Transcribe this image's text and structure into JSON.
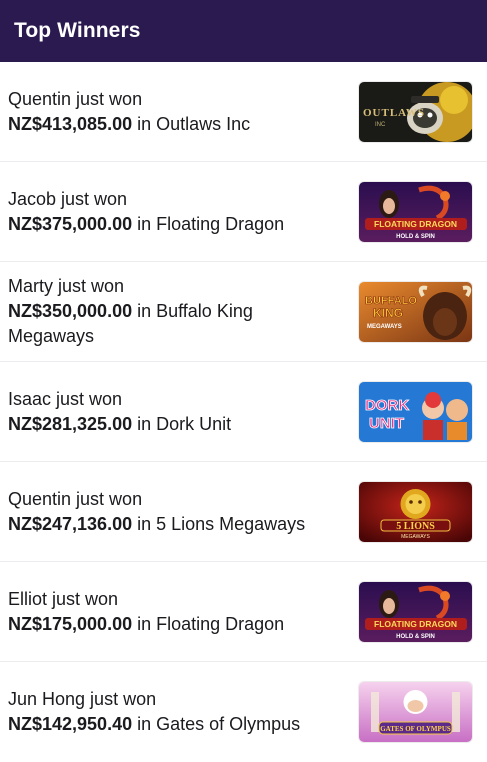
{
  "header": {
    "title": "Top Winners"
  },
  "winners": [
    {
      "name_line": "Quentin just won",
      "amount": "NZ$413,085.00",
      "game_text": " in Outlaws Inc",
      "thumb_icon": "outlaws-inc-game-icon",
      "thumb_label": "OUTLAWS"
    },
    {
      "name_line": "Jacob just won",
      "amount": "NZ$375,000.00",
      "game_text": " in Floating Dragon",
      "thumb_icon": "floating-dragon-game-icon",
      "thumb_label": "FLOATING DRAGON"
    },
    {
      "name_line": "Marty just won",
      "amount": "NZ$350,000.00",
      "game_text": " in Buffalo King Megaways",
      "thumb_icon": "buffalo-king-game-icon",
      "thumb_label": "BUFFALO KING"
    },
    {
      "name_line": "Isaac just won",
      "amount": "NZ$281,325.00",
      "game_text": " in Dork Unit",
      "thumb_icon": "dork-unit-game-icon",
      "thumb_label": "DORK UNIT"
    },
    {
      "name_line": "Quentin just won",
      "amount": "NZ$247,136.00",
      "game_text": " in 5 Lions Megaways",
      "thumb_icon": "5-lions-game-icon",
      "thumb_label": "5 LIONS"
    },
    {
      "name_line": "Elliot just won",
      "amount": "NZ$175,000.00",
      "game_text": " in Floating Dragon",
      "thumb_icon": "floating-dragon-game-icon",
      "thumb_label": "FLOATING DRAGON"
    },
    {
      "name_line": "Jun Hong just won",
      "amount": "NZ$142,950.40",
      "game_text": " in Gates of Olympus",
      "thumb_icon": "gates-of-olympus-game-icon",
      "thumb_label": "GATES OF OLYMPUS"
    }
  ]
}
